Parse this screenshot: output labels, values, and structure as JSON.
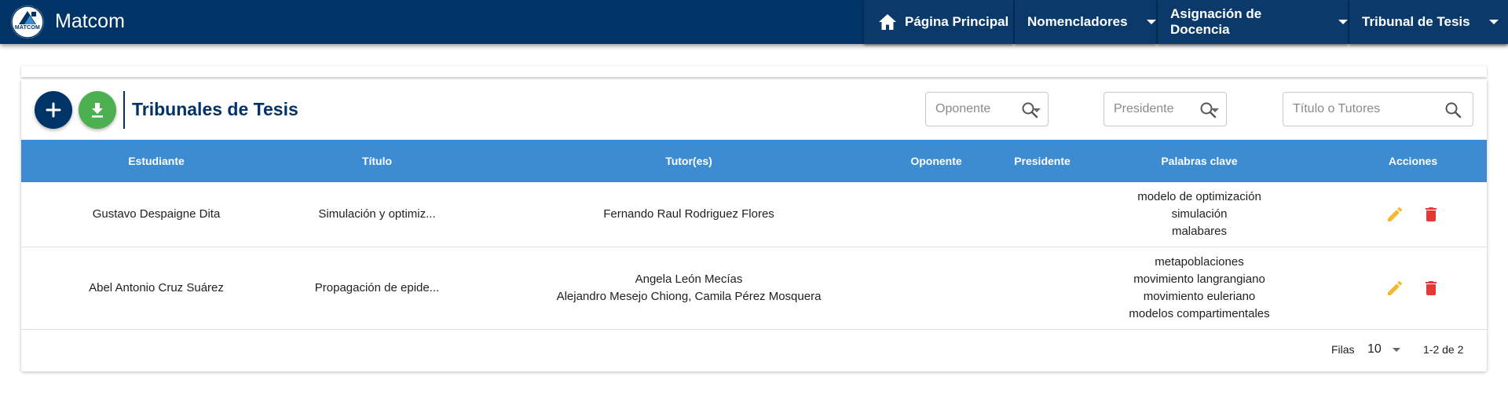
{
  "app": {
    "brand": "Matcom",
    "logo_text": "MATCOM"
  },
  "nav": {
    "home_label": "Página Principal",
    "items": [
      {
        "label": "Nomencladores",
        "icon": "caret-down-icon"
      },
      {
        "label": "Asignación de Docencia",
        "icon": "caret-down-icon"
      },
      {
        "label": "Tribunal de Tesis",
        "icon": "caret-down-icon"
      }
    ]
  },
  "page": {
    "title": "Tribunales de Tesis",
    "add_icon": "plus-icon",
    "download_icon": "download-icon"
  },
  "filters": {
    "oponente_placeholder": "Oponente",
    "presidente_placeholder": "Presidente",
    "titulo_placeholder": "Título o Tutores"
  },
  "table": {
    "columns": [
      "Estudiante",
      "Título",
      "Tutor(es)",
      "Oponente",
      "Presidente",
      "Palabras clave",
      "Acciones"
    ],
    "rows": [
      {
        "estudiante": "Gustavo Despaigne Dita",
        "titulo": "Simulación y optimiz...",
        "tutores": [
          "Fernando Raul Rodriguez Flores"
        ],
        "oponente": "",
        "presidente": "",
        "palabras": [
          "modelo de optimización",
          "simulación",
          "malabares"
        ]
      },
      {
        "estudiante": "Abel Antonio Cruz Suárez",
        "titulo": "Propagación de epide...",
        "tutores": [
          "Angela León Mecías",
          "Alejandro Mesejo Chiong, Camila Pérez Mosquera"
        ],
        "oponente": "",
        "presidente": "",
        "palabras": [
          "metapoblaciones",
          "movimiento langrangiano",
          "movimiento euleriano",
          "modelos compartimentales"
        ]
      }
    ]
  },
  "pagination": {
    "rows_label": "Filas",
    "rows_value": "10",
    "range": "1-2 de 2"
  },
  "colors": {
    "navbar": "#003366",
    "header": "#3d8bd1",
    "add_fab": "#003366",
    "download_fab": "#4caf50",
    "edit_icon": "#f5b82e",
    "delete_icon": "#e53935"
  }
}
